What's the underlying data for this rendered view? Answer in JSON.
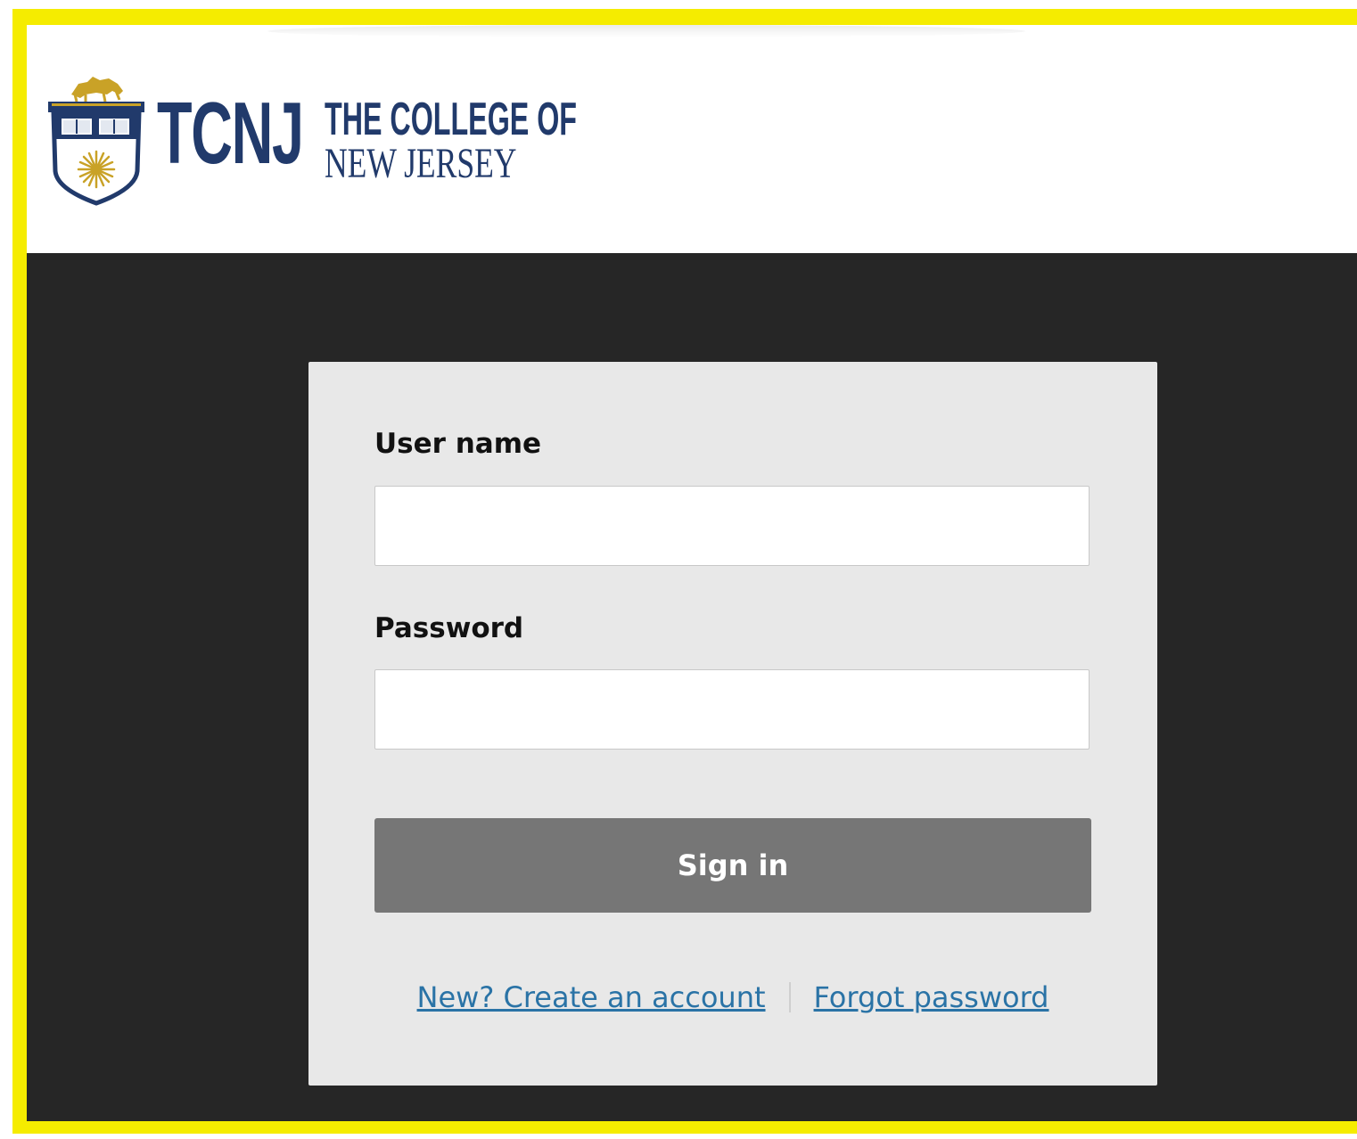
{
  "header": {
    "logo": {
      "wordmark": "TCNJ",
      "line1": "THE COLLEGE OF",
      "line2": "NEW JERSEY",
      "brand_color": "#213a6b",
      "crest_accent": "#c9a227"
    }
  },
  "login": {
    "username_label": "User name",
    "username_value": "",
    "password_label": "Password",
    "password_value": "",
    "signin_label": "Sign in",
    "create_account_link": "New? Create an account",
    "forgot_password_link": "Forgot password"
  },
  "colors": {
    "frame_highlight": "#f5ec00",
    "background_dark": "#262626",
    "card_background": "#e8e8e8",
    "button_background": "#767676",
    "link": "#2a73a6"
  }
}
